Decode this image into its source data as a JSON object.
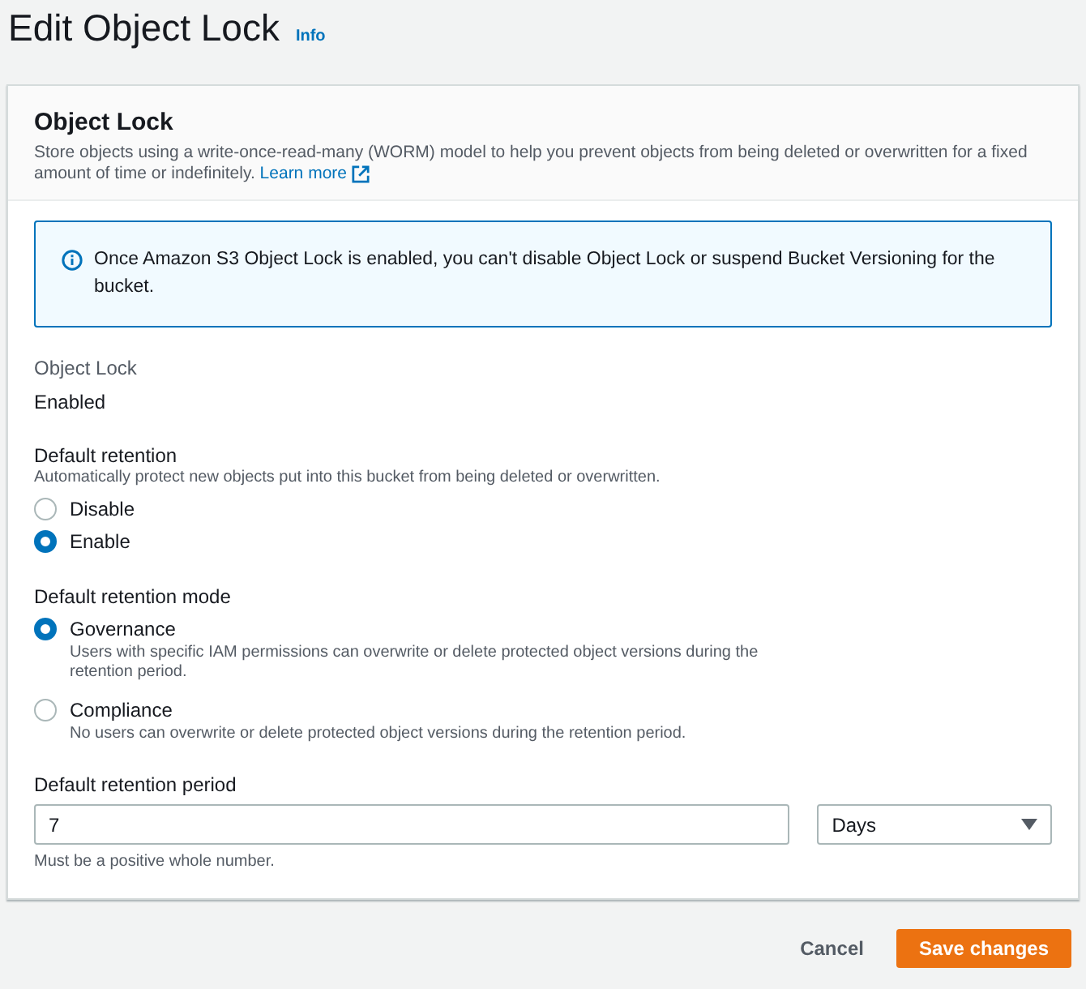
{
  "page": {
    "title": "Edit Object Lock",
    "info_link": "Info"
  },
  "panel": {
    "title": "Object Lock",
    "description": "Store objects using a write-once-read-many (WORM) model to help you prevent objects from being deleted or overwritten for a fixed amount of time or indefinitely.",
    "learn_more_link": "Learn more"
  },
  "alert": {
    "text": "Once Amazon S3 Object Lock is enabled, you can't disable Object Lock or suspend Bucket Versioning for the bucket."
  },
  "object_lock": {
    "label": "Object Lock",
    "value": "Enabled"
  },
  "default_retention": {
    "label": "Default retention",
    "description": "Automatically protect new objects put into this bucket from being deleted or overwritten.",
    "options": [
      {
        "label": "Disable",
        "selected": false
      },
      {
        "label": "Enable",
        "selected": true
      }
    ]
  },
  "retention_mode": {
    "label": "Default retention mode",
    "options": [
      {
        "label": "Governance",
        "description": "Users with specific IAM permissions can overwrite or delete protected object versions during the retention period.",
        "selected": true
      },
      {
        "label": "Compliance",
        "description": "No users can overwrite or delete protected object versions during the retention period.",
        "selected": false
      }
    ]
  },
  "retention_period": {
    "label": "Default retention period",
    "value": "7",
    "unit": "Days",
    "hint": "Must be a positive whole number."
  },
  "buttons": [
    {
      "label": "Cancel",
      "kind": "link"
    },
    {
      "label": "Save changes",
      "kind": "primary"
    }
  ]
}
